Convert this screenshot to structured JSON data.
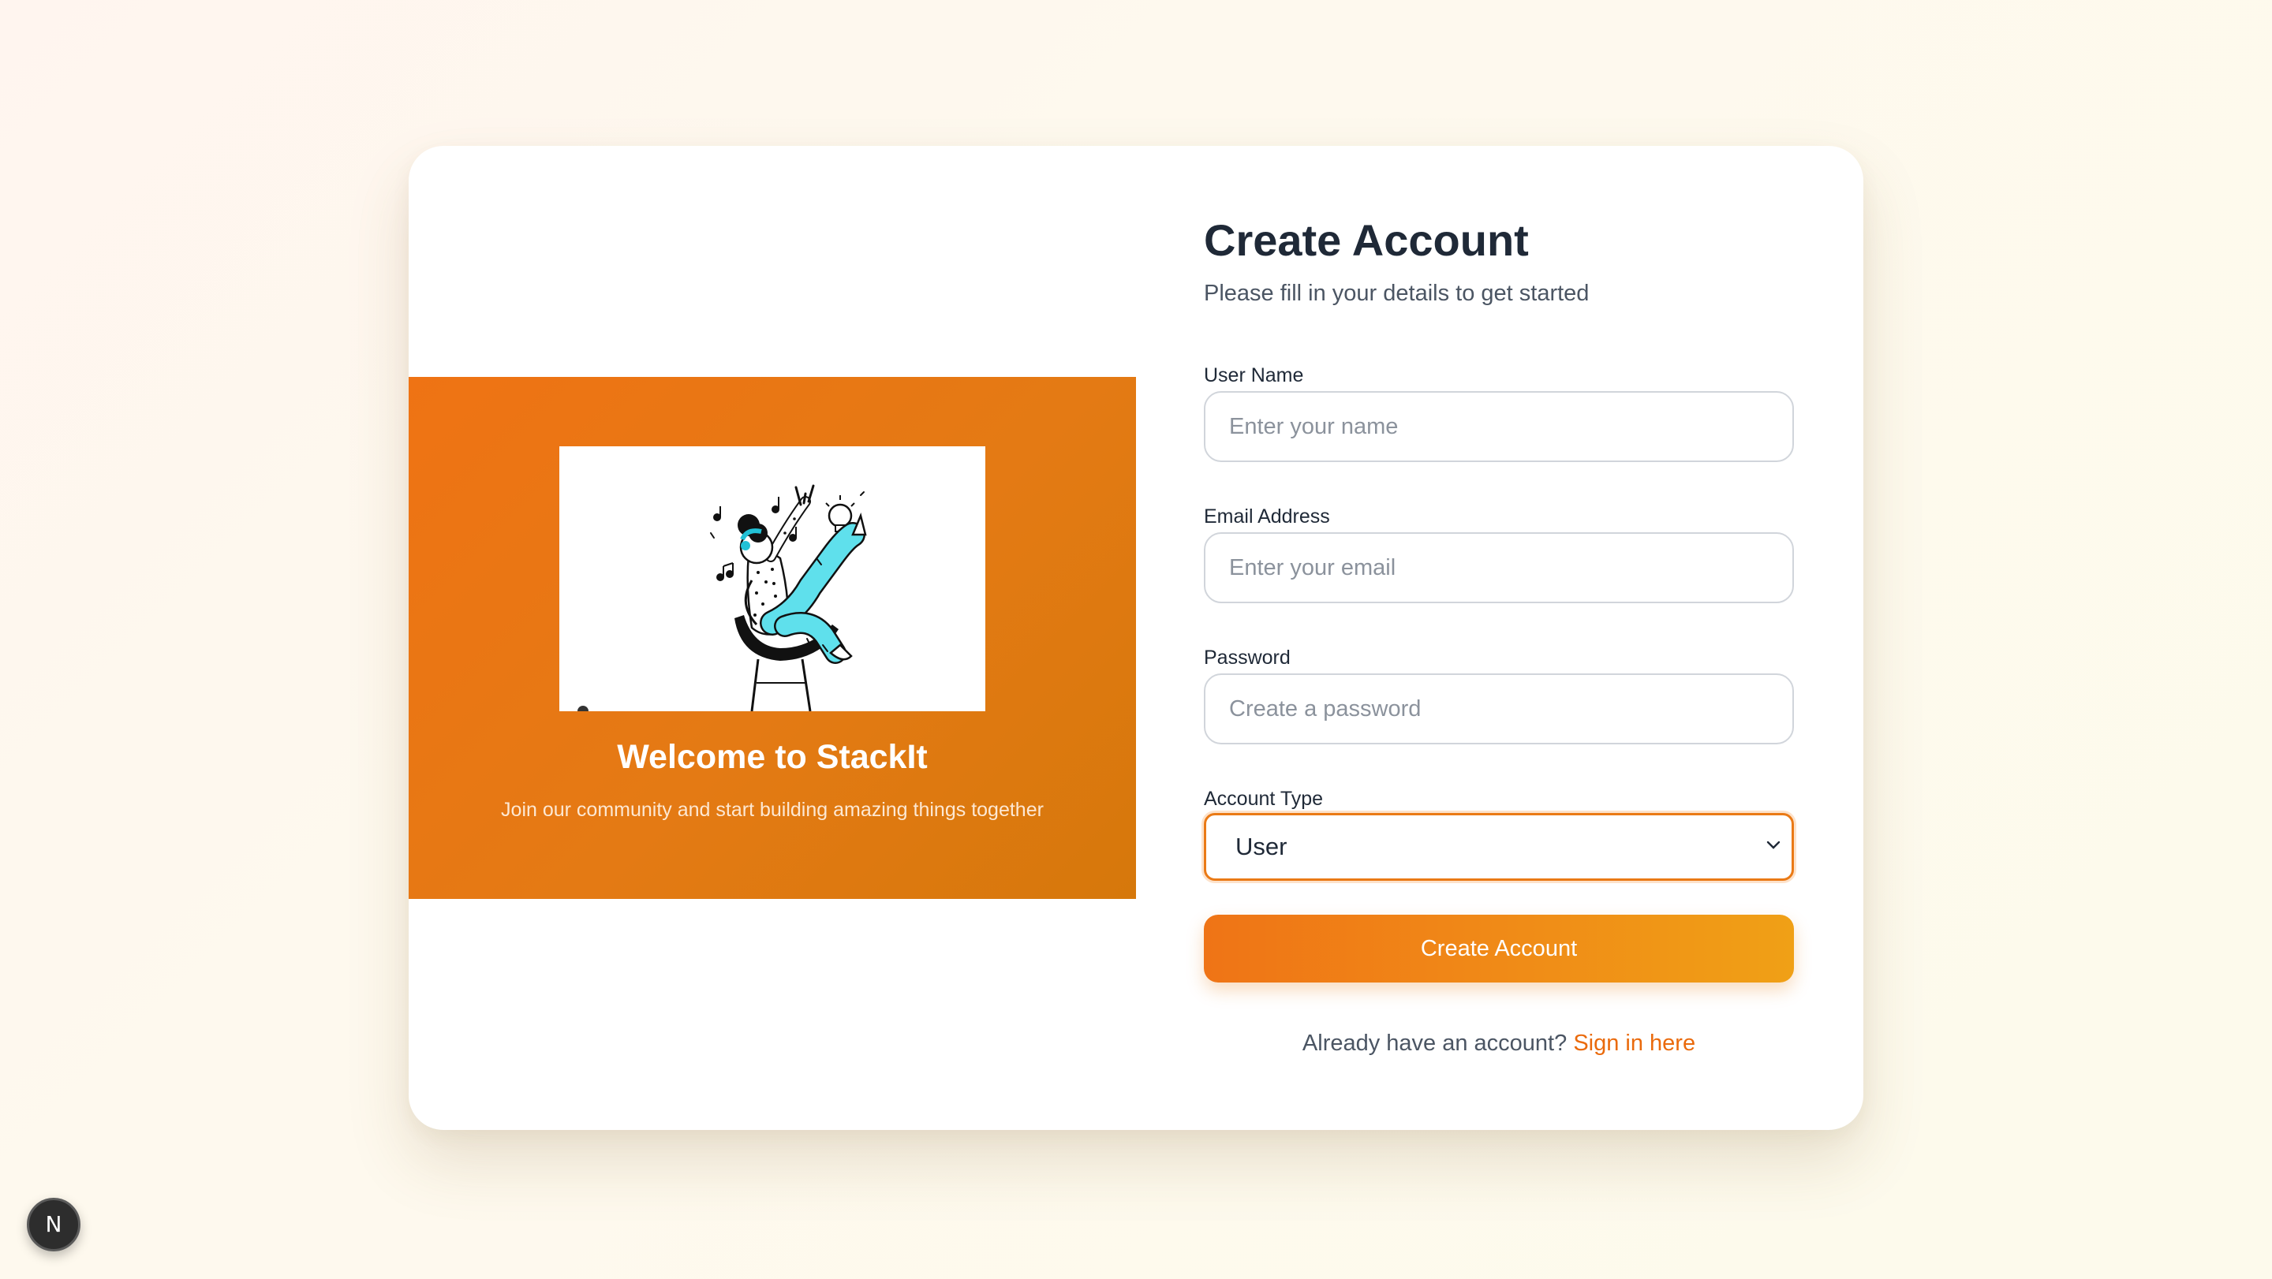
{
  "hero": {
    "title": "Welcome to StackIt",
    "subtitle": "Join our community and start building amazing things together",
    "illustration_icon": "person-on-chair-with-music-and-lightbulb-illustration"
  },
  "form": {
    "title": "Create Account",
    "subtitle": "Please fill in your details to get started",
    "username": {
      "label": "User Name",
      "placeholder": "Enter your name",
      "value": ""
    },
    "email": {
      "label": "Email Address",
      "placeholder": "Enter your email",
      "value": ""
    },
    "password": {
      "label": "Password",
      "placeholder": "Create a password",
      "value": ""
    },
    "account_type": {
      "label": "Account Type",
      "selected": "User",
      "icon": "chevron-down-icon"
    },
    "submit_label": "Create Account",
    "signin_prompt": "Already have an account?",
    "signin_link": "Sign in here"
  },
  "dev_badge": {
    "label": "N",
    "icon": "nextjs-logo-icon"
  },
  "colors": {
    "accent": "#ef7416",
    "accent_end": "#f0a016",
    "link": "#ea6a0c",
    "heading": "#1f2937",
    "background": "#fef9ee"
  }
}
